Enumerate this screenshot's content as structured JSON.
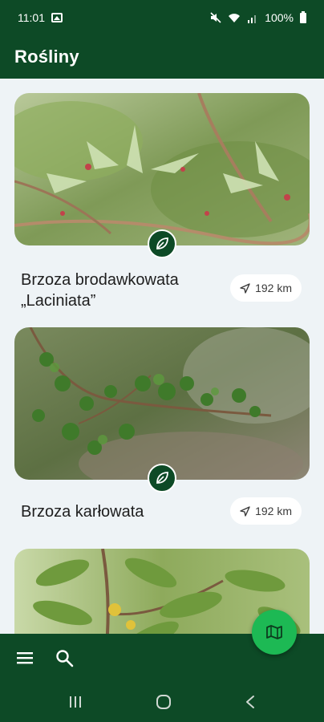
{
  "status_bar": {
    "time": "11:01",
    "battery": "100%"
  },
  "app_bar": {
    "title": "Rośliny"
  },
  "plants": [
    {
      "name_line1": "Brzoza brodawkowata",
      "name_line2": "„Laciniata”",
      "distance": "192 km"
    },
    {
      "name_line1": "Brzoza karłowata",
      "name_line2": "",
      "distance": "192 km"
    }
  ],
  "icons": {
    "leaf": "leaf-icon",
    "navigation": "navigation-arrow-icon",
    "menu": "menu-icon",
    "search": "search-icon",
    "map": "map-icon",
    "recents": "recent-apps-icon",
    "home": "home-icon",
    "back": "back-icon"
  },
  "colors": {
    "brand_dark_green": "#0d4a26",
    "fab_green": "#1db954",
    "background": "#eef3f6"
  }
}
